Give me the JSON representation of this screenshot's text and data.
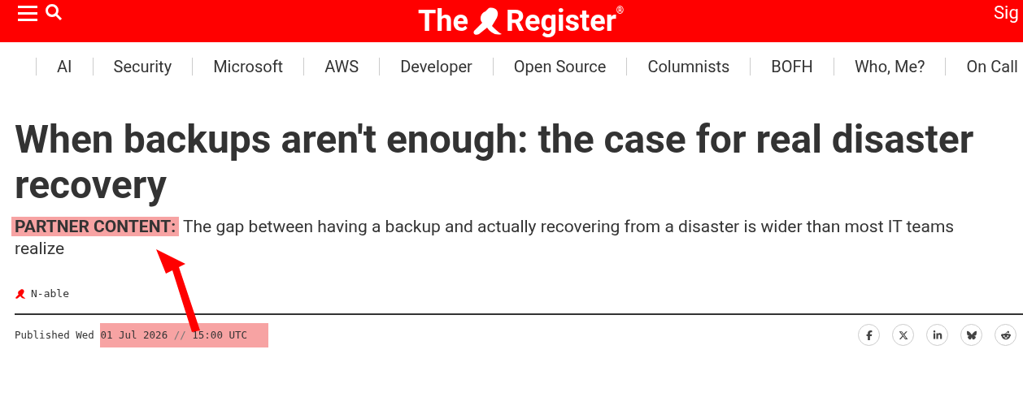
{
  "header": {
    "logo": {
      "first": "The",
      "second": "Register",
      "mark": "®"
    },
    "sign_in": "Sig"
  },
  "nav": {
    "items": [
      "AI",
      "Security",
      "Microsoft",
      "AWS",
      "Developer",
      "Open Source",
      "Columnists",
      "BOFH",
      "Who, Me?",
      "On Call"
    ]
  },
  "article": {
    "title": "When backups aren't enough: the case for real disaster recovery",
    "kicker": "PARTNER CONTENT:",
    "standfirst": "The gap between having a backup and actually recovering from a disaster is wider than most IT teams realize",
    "author": "N-able",
    "published_label": "Published",
    "day": "Wed",
    "date": "01 Jul 2026",
    "separator": "//",
    "time": "15:00 UTC"
  },
  "share": [
    {
      "kind": "facebook"
    },
    {
      "kind": "x"
    },
    {
      "kind": "linkedin"
    },
    {
      "kind": "bluesky"
    },
    {
      "kind": "reddit"
    }
  ]
}
